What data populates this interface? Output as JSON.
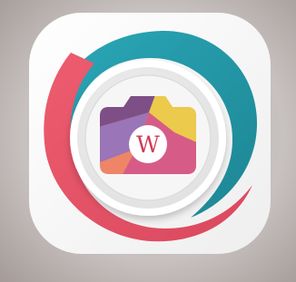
{
  "home_screen": {
    "wallpaper_colors": {
      "top_left": "#9d9390",
      "center": "#bcb5b1",
      "bottom_right": "#c7c1bf"
    },
    "app_icon": {
      "icon_name": "camera-app-icon",
      "monogram": "W",
      "colors": {
        "tile_light": "#ffffff",
        "tile_shade": "#eeeeee",
        "ring_teal": "#2aa8b8",
        "ring_teal_dark": "#1d8593",
        "ring_coral": "#ee5c6f",
        "ring_coral_dark": "#d9485d",
        "plate_outer": "#f1f1f1",
        "plate_inner": "#e1e1e1",
        "camera_purple": "#7e4f86",
        "camera_yellow": "#ebca4c",
        "camera_orange": "#ef8567",
        "camera_pink": "#d65c87",
        "camera_lavender": "#9a75b7",
        "badge_fill": "#ffffff",
        "monogram_color": "#d13c55"
      }
    }
  }
}
